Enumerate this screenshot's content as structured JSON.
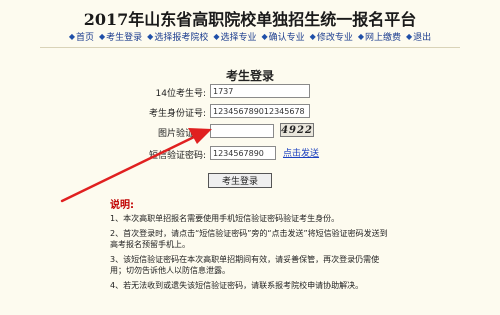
{
  "page_title": "2017年山东省高职院校单独招生统一报名平台",
  "nav": [
    {
      "name": "nav-home",
      "label": "首页"
    },
    {
      "name": "nav-login",
      "label": "考生登录"
    },
    {
      "name": "nav-select-college",
      "label": "选择报考院校"
    },
    {
      "name": "nav-select-major",
      "label": "选择专业"
    },
    {
      "name": "nav-confirm-major",
      "label": "确认专业"
    },
    {
      "name": "nav-modify-major",
      "label": "修改专业"
    },
    {
      "name": "nav-pay",
      "label": "网上缴费"
    },
    {
      "name": "nav-logout",
      "label": "退出"
    }
  ],
  "form": {
    "title": "考生登录",
    "exam_no_label": "14位考生号:",
    "exam_no_value": "1737",
    "id_label": "考生身份证号:",
    "id_value": "123456789012345678",
    "captcha_label": "图片验证码:",
    "captcha_value": "",
    "captcha_text": "4922",
    "sms_label": "短信验证密码:",
    "sms_value": "1234567890",
    "sms_link": "点击发送",
    "login_button": "考生登录"
  },
  "notes": {
    "heading": "说明:",
    "items": [
      "1、本次高职单招报名需要使用手机短信验证密码验证考生身份。",
      "2、首次登录时，请点击“短信验证密码”旁的“点击发送”将短信验证密码发送到高考报名预留手机上。",
      "3、该短信验证密码在本次高职单招期间有效，请妥善保管，再次登录仍需使用；切勿告诉他人以防信息泄露。",
      "4、若无法收到或遗失该短信验证密码，请联系报考院校申请协助解决。"
    ]
  },
  "colors": {
    "background": "#fdfbef",
    "nav_text": "#1c3d8f",
    "note_heading": "#c00000",
    "arrow": "#e02020",
    "link": "#1a3fbf"
  },
  "icons": {
    "nav_bullet": "diamond-icon"
  }
}
